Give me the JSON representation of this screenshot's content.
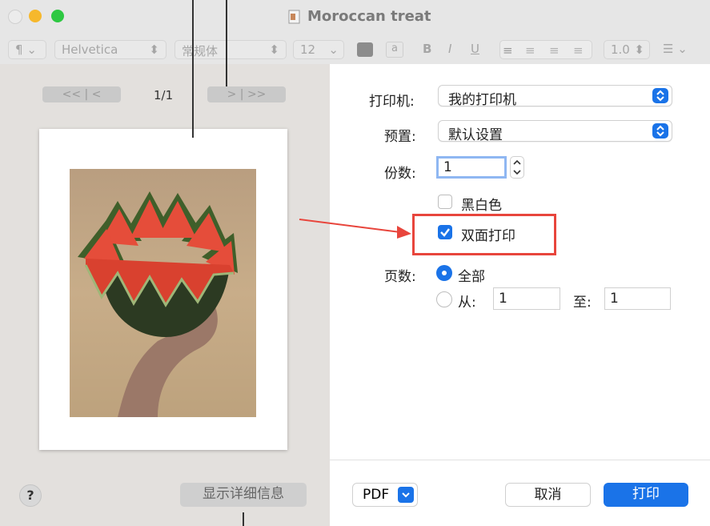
{
  "window": {
    "title": "Moroccan treat",
    "traffic": {
      "close_color": "#ececec",
      "minimize_color": "#f6b82c",
      "zoom_color": "#2ec842"
    }
  },
  "toolbar": {
    "paragraph_label": "¶",
    "font_family": "Helvetica",
    "font_style": "常规体",
    "font_size": "12",
    "bold": "B",
    "italic": "I",
    "underline": "U",
    "line_spacing": "1.0"
  },
  "preview": {
    "first_prev": "<<  |  <",
    "next_last": ">  |  >>",
    "page_counter": "1/1",
    "show_details": "显示详细信息",
    "help": "?"
  },
  "print": {
    "printer_label": "打印机:",
    "printer_value": "我的打印机",
    "presets_label": "预置:",
    "presets_value": "默认设置",
    "copies_label": "份数:",
    "copies_value": "1",
    "bw_label": "黑白色",
    "bw_checked": false,
    "duplex_label": "双面打印",
    "duplex_checked": true,
    "pages_label": "页数:",
    "pages_all": "全部",
    "pages_from": "从:",
    "from_value": "1",
    "pages_to": "至:",
    "to_value": "1"
  },
  "footer": {
    "pdf": "PDF",
    "cancel": "取消",
    "print": "打印"
  },
  "colors": {
    "accent": "#1a73e8",
    "annotation_red": "#e8453c"
  }
}
